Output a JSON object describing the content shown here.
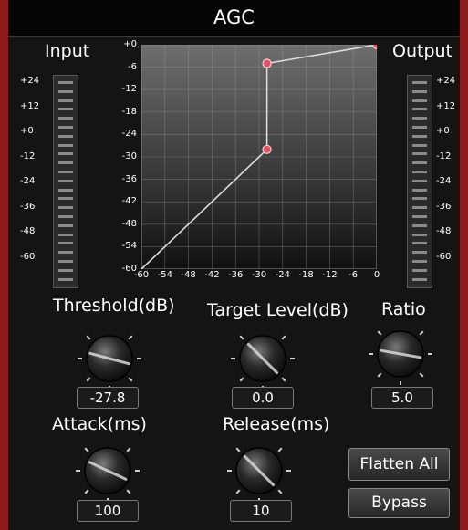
{
  "window": {
    "title": "AGC"
  },
  "input_meter": {
    "label": "Input",
    "scale": [
      "+24",
      "+12",
      "+0",
      "-12",
      "-24",
      "-36",
      "-48",
      "-60"
    ]
  },
  "output_meter": {
    "label": "Output",
    "scale": [
      "+24",
      "+12",
      "+0",
      "-12",
      "-24",
      "-36",
      "-48",
      "-60"
    ]
  },
  "graph": {
    "y_ticks": [
      "+0",
      "-6",
      "-12",
      "-18",
      "-24",
      "-30",
      "-36",
      "-42",
      "-48",
      "-54",
      "-60"
    ],
    "x_ticks": [
      "-60",
      "-54",
      "-48",
      "-42",
      "-36",
      "-30",
      "-24",
      "-18",
      "-12",
      "-6",
      "0"
    ],
    "curve": [
      {
        "in": -60,
        "out": -60
      },
      {
        "in": -28,
        "out": -28
      },
      {
        "in": -28,
        "out": -5
      },
      {
        "in": 0,
        "out": 0
      }
    ],
    "handles": [
      {
        "in": -28,
        "out": -28
      },
      {
        "in": -28,
        "out": -5
      },
      {
        "in": 0,
        "out": 0
      }
    ]
  },
  "controls": {
    "threshold": {
      "label": "Threshold(dB)",
      "value": "-27.8"
    },
    "target_level": {
      "label": "Target Level(dB)",
      "value": "0.0"
    },
    "ratio": {
      "label": "Ratio",
      "value": "5.0"
    },
    "attack": {
      "label": "Attack(ms)",
      "value": "100"
    },
    "release": {
      "label": "Release(ms)",
      "value": "10"
    }
  },
  "buttons": {
    "flatten_all": "Flatten All",
    "bypass": "Bypass"
  },
  "colors": {
    "frame": "#8e1c1c",
    "curve": "#dddddd",
    "handle": "#e05060"
  }
}
